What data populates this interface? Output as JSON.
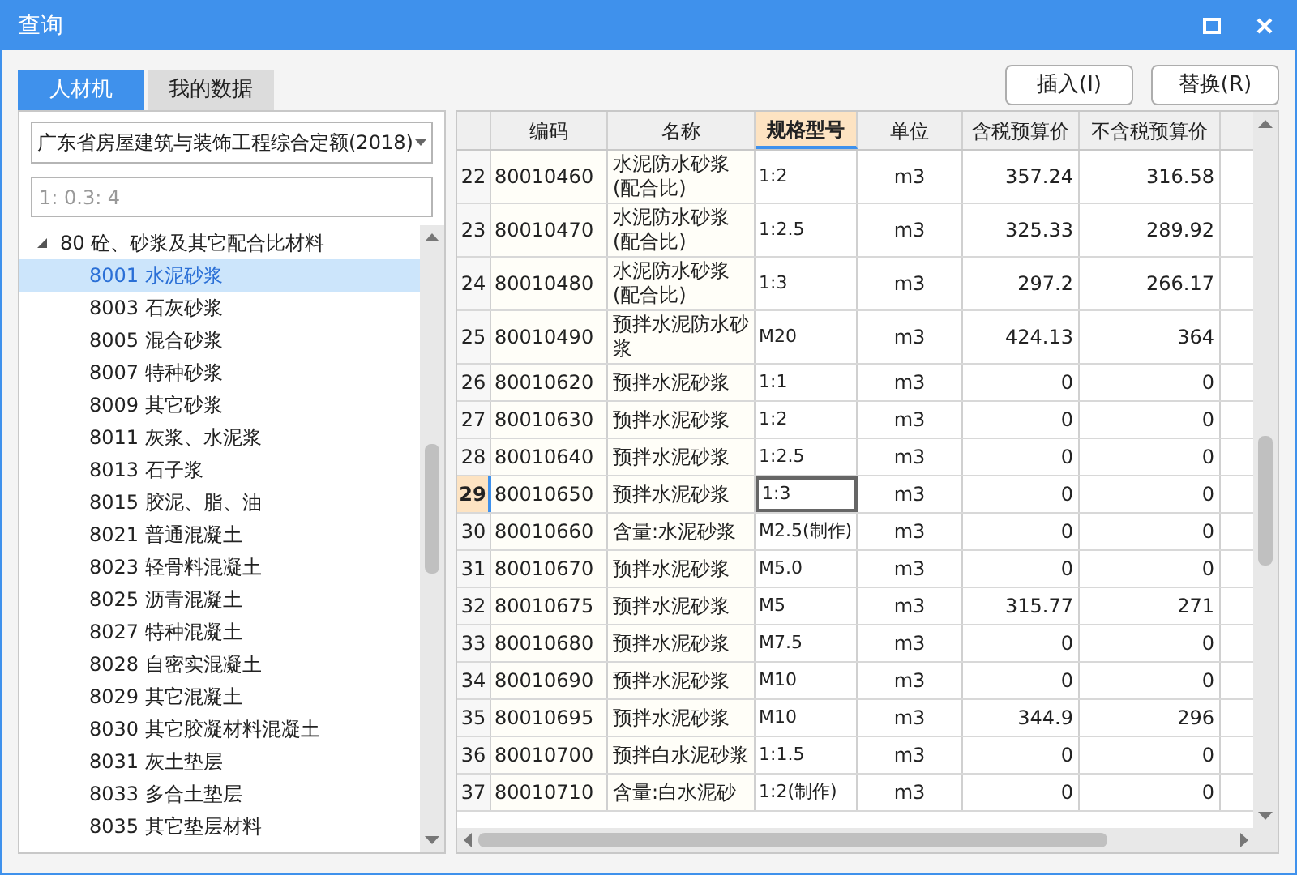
{
  "window": {
    "title": "查询"
  },
  "tabs": [
    {
      "label": "人材机",
      "selected": true
    },
    {
      "label": "我的数据",
      "selected": false
    }
  ],
  "buttons": [
    "插入(I)",
    "替换(R)"
  ],
  "quota_select": {
    "value": "广东省房屋建筑与装饰工程综合定额(2018)"
  },
  "search": {
    "value": "1: 0.3: 4"
  },
  "tree": [
    {
      "label": "80 砼、砂浆及其它配合比材料",
      "expanded": true,
      "selected": false,
      "children": [
        {
          "label": "8001 水泥砂浆",
          "selected": true
        },
        {
          "label": "8003 石灰砂浆",
          "selected": false
        },
        {
          "label": "8005 混合砂浆",
          "selected": false
        },
        {
          "label": "8007 特种砂浆",
          "selected": false
        },
        {
          "label": "8009 其它砂浆",
          "selected": false
        },
        {
          "label": "8011 灰浆、水泥浆",
          "selected": false
        },
        {
          "label": "8013 石子浆",
          "selected": false
        },
        {
          "label": "8015 胶泥、脂、油",
          "selected": false
        },
        {
          "label": "8021 普通混凝土",
          "selected": false
        },
        {
          "label": "8023 轻骨料混凝土",
          "selected": false
        },
        {
          "label": "8025 沥青混凝土",
          "selected": false
        },
        {
          "label": "8027 特种混凝土",
          "selected": false
        },
        {
          "label": "8028 自密实混凝土",
          "selected": false
        },
        {
          "label": "8029 其它混凝土",
          "selected": false
        },
        {
          "label": "8030 其它胶凝材料混凝土",
          "selected": false
        },
        {
          "label": "8031 灰土垫层",
          "selected": false
        },
        {
          "label": "8033 多合土垫层",
          "selected": false
        },
        {
          "label": "8035 其它垫层材料",
          "selected": false
        }
      ]
    }
  ],
  "table": {
    "columns": [
      {
        "label": "编码",
        "selected": false
      },
      {
        "label": "名称",
        "selected": false
      },
      {
        "label": "规格型号",
        "selected": true
      },
      {
        "label": "单位",
        "selected": false
      },
      {
        "label": "含税预算价",
        "selected": false
      },
      {
        "label": "不含税预算价",
        "selected": false
      }
    ],
    "rows": [
      {
        "num": "22",
        "code": "80010460",
        "name": "水泥防水砂浆(配合比)",
        "spec": "1:2",
        "unit": "m3",
        "tax": "357.24",
        "notax": "316.58",
        "selected": false
      },
      {
        "num": "23",
        "code": "80010470",
        "name": "水泥防水砂浆(配合比)",
        "spec": "1:2.5",
        "unit": "m3",
        "tax": "325.33",
        "notax": "289.92",
        "selected": false
      },
      {
        "num": "24",
        "code": "80010480",
        "name": "水泥防水砂浆(配合比)",
        "spec": "1:3",
        "unit": "m3",
        "tax": "297.2",
        "notax": "266.17",
        "selected": false
      },
      {
        "num": "25",
        "code": "80010490",
        "name": "预拌水泥防水砂浆",
        "spec": "M20",
        "unit": "m3",
        "tax": "424.13",
        "notax": "364",
        "selected": false
      },
      {
        "num": "26",
        "code": "80010620",
        "name": "预拌水泥砂浆",
        "spec": "1:1",
        "unit": "m3",
        "tax": "0",
        "notax": "0",
        "selected": false
      },
      {
        "num": "27",
        "code": "80010630",
        "name": "预拌水泥砂浆",
        "spec": "1:2",
        "unit": "m3",
        "tax": "0",
        "notax": "0",
        "selected": false
      },
      {
        "num": "28",
        "code": "80010640",
        "name": "预拌水泥砂浆",
        "spec": "1:2.5",
        "unit": "m3",
        "tax": "0",
        "notax": "0",
        "selected": false
      },
      {
        "num": "29",
        "code": "80010650",
        "name": "预拌水泥砂浆",
        "spec": "1:3",
        "unit": "m3",
        "tax": "0",
        "notax": "0",
        "selected": true
      },
      {
        "num": "30",
        "code": "80010660",
        "name": "含量:水泥砂浆",
        "spec": "M2.5(制作)",
        "unit": "m3",
        "tax": "0",
        "notax": "0",
        "selected": false
      },
      {
        "num": "31",
        "code": "80010670",
        "name": "预拌水泥砂浆",
        "spec": "M5.0",
        "unit": "m3",
        "tax": "0",
        "notax": "0",
        "selected": false
      },
      {
        "num": "32",
        "code": "80010675",
        "name": "预拌水泥砂浆",
        "spec": "M5",
        "unit": "m3",
        "tax": "315.77",
        "notax": "271",
        "selected": false
      },
      {
        "num": "33",
        "code": "80010680",
        "name": "预拌水泥砂浆",
        "spec": "M7.5",
        "unit": "m3",
        "tax": "0",
        "notax": "0",
        "selected": false
      },
      {
        "num": "34",
        "code": "80010690",
        "name": "预拌水泥砂浆",
        "spec": "M10",
        "unit": "m3",
        "tax": "0",
        "notax": "0",
        "selected": false
      },
      {
        "num": "35",
        "code": "80010695",
        "name": "预拌水泥砂浆",
        "spec": "M10",
        "unit": "m3",
        "tax": "344.9",
        "notax": "296",
        "selected": false
      },
      {
        "num": "36",
        "code": "80010700",
        "name": "预拌白水泥砂浆",
        "spec": "1:1.5",
        "unit": "m3",
        "tax": "0",
        "notax": "0",
        "selected": false
      },
      {
        "num": "37",
        "code": "80010710",
        "name": "含量:白水泥砂",
        "spec": "1:2(制作)",
        "unit": "m3",
        "tax": "0",
        "notax": "0",
        "selected": false
      }
    ]
  }
}
